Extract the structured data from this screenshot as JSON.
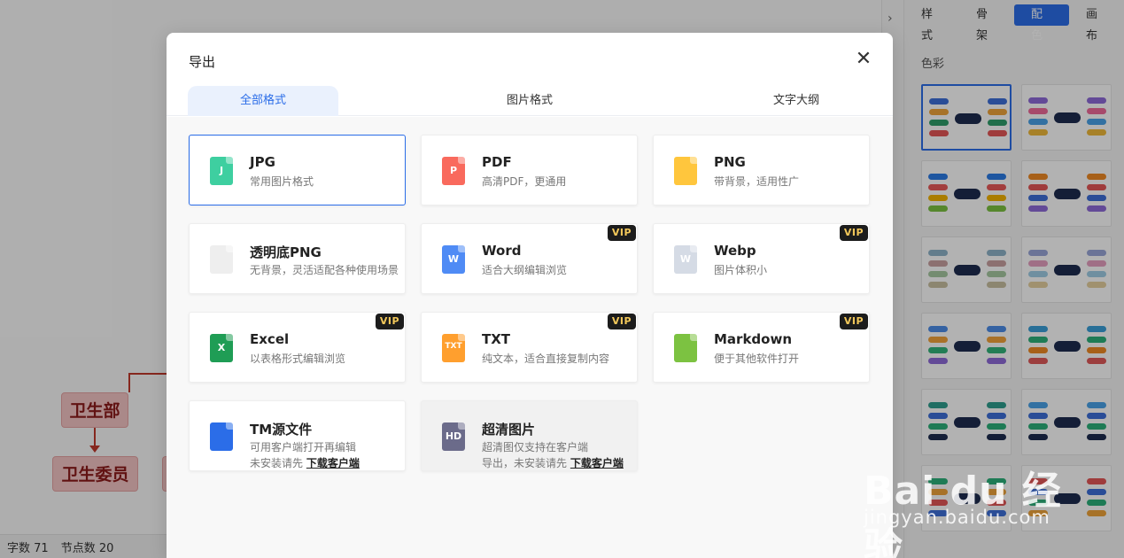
{
  "mindmap": {
    "node_parent": "卫生部",
    "node_child": "卫生委员",
    "node_color": "#f4c4c4",
    "line_color": "#c0392b"
  },
  "statusbar": {
    "words": "字数 71",
    "nodes": "节点数 20"
  },
  "side_panel": {
    "tabs": [
      "样式",
      "骨架",
      "配色",
      "画布"
    ],
    "active_tab": "配色",
    "section_title": "色彩",
    "accent": "#2b6de8"
  },
  "dialog": {
    "title": "导出",
    "close_icon": "close-icon",
    "tabs": [
      {
        "label": "全部格式",
        "active": true
      },
      {
        "label": "图片格式",
        "active": false
      },
      {
        "label": "文字大纲",
        "active": false
      }
    ],
    "vip_label": "VIP",
    "formats": [
      {
        "title": "JPG",
        "desc": "常用图片格式",
        "icon": "jpg-file-icon",
        "glyph": "J",
        "color": "#3ecfa0",
        "vip": false,
        "selected": true
      },
      {
        "title": "PDF",
        "desc": "高清PDF，更通用",
        "icon": "pdf-file-icon",
        "glyph": "P",
        "color": "#f96a5d",
        "vip": false
      },
      {
        "title": "PNG",
        "desc": "带背景，适用性广",
        "icon": "png-file-icon",
        "glyph": "",
        "color": "#ffc63d",
        "vip": false
      },
      {
        "title": "透明底PNG",
        "desc": "无背景，灵活适配各种使用场景",
        "icon": "transparent-png-file-icon",
        "glyph": "",
        "color": "#eeeeee",
        "vip": false
      },
      {
        "title": "Word",
        "desc": "适合大纲编辑浏览",
        "icon": "word-file-icon",
        "glyph": "W",
        "color": "#4f8bf5",
        "vip": true
      },
      {
        "title": "Webp",
        "desc": "图片体积小",
        "icon": "webp-file-icon",
        "glyph": "W",
        "color": "#d5dbe5",
        "vip": true
      },
      {
        "title": "Excel",
        "desc": "以表格形式编辑浏览",
        "icon": "excel-file-icon",
        "glyph": "X",
        "color": "#1f9d55",
        "vip": true
      },
      {
        "title": "TXT",
        "desc": "纯文本，适合直接复制内容",
        "icon": "txt-file-icon",
        "glyph": "TXT",
        "color": "#ff9f2e",
        "vip": true
      },
      {
        "title": "Markdown",
        "desc": "便于其他软件打开",
        "icon": "markdown-file-icon",
        "glyph": "",
        "color": "#7cc241",
        "vip": true
      },
      {
        "title": "TM源文件",
        "desc": "可用客户端打开再编辑",
        "desc2": "未安装请先",
        "link": "下载客户端",
        "icon": "tm-source-file-icon",
        "glyph": "",
        "color": "#2b6de8",
        "vip": false
      },
      {
        "title": "超清图片",
        "desc": "超清图仅支持在客户端",
        "desc2": "导出，未安装请先",
        "link": "下载客户端",
        "icon": "hd-image-file-icon",
        "glyph": "HD",
        "color": "#6b6b8a",
        "vip": false,
        "disabled": true
      }
    ]
  },
  "watermark": {
    "main": "Bai du 经验",
    "sub": "jingyan.baidu.com"
  }
}
